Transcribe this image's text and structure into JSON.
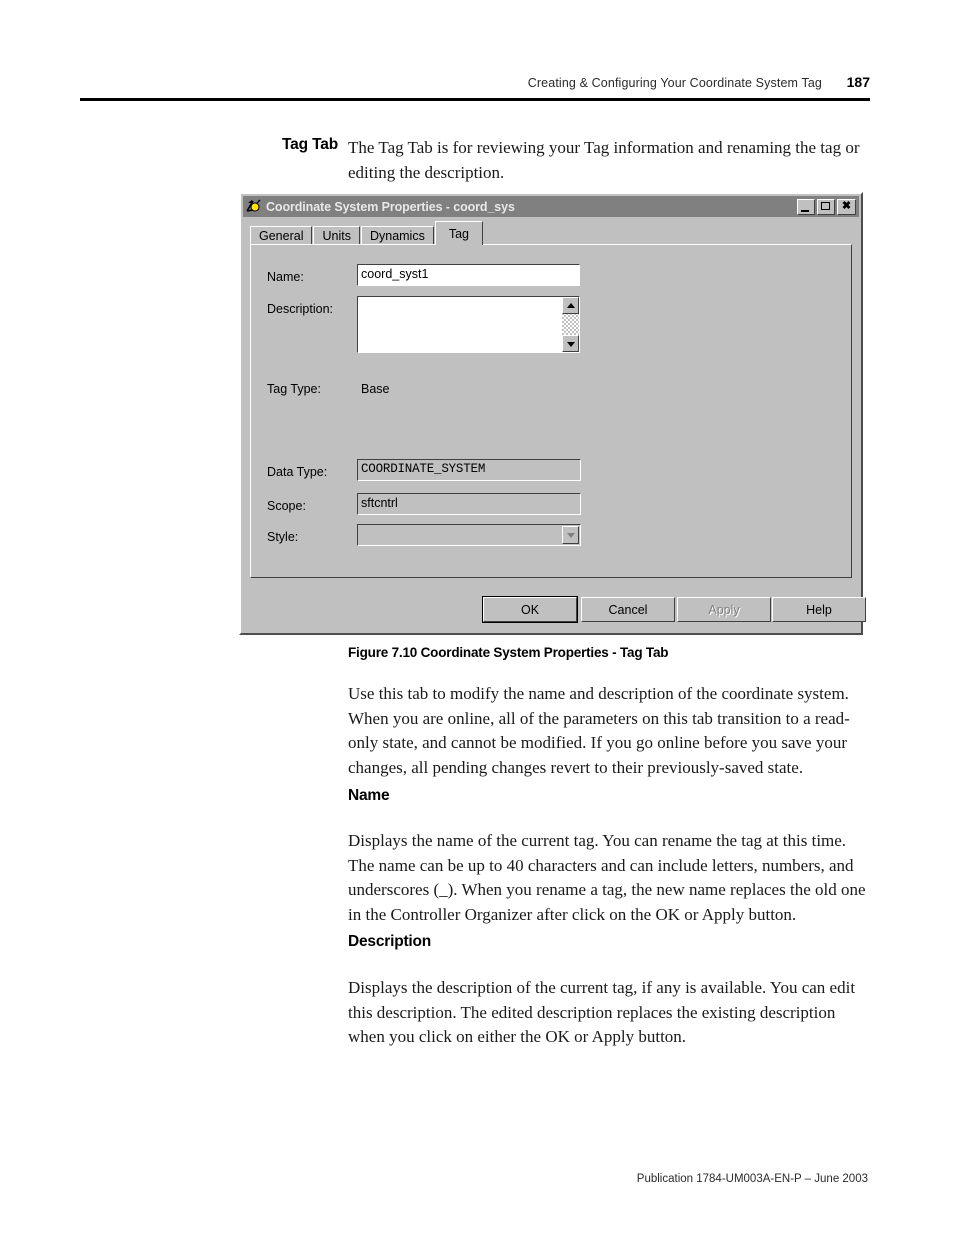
{
  "page": {
    "header_title": "Creating & Configuring Your Coordinate System Tag",
    "page_number": "187",
    "footer": "Publication 1784-UM003A-EN-P – June 2003"
  },
  "section": {
    "label": "Tag Tab",
    "intro": "The Tag Tab is for reviewing your Tag information and renaming the tag or editing the description."
  },
  "dialog": {
    "title": "Coordinate System Properties - coord_sys",
    "icon": "coordinate-system-icon",
    "window_buttons": {
      "minimize": "minimize-icon",
      "maximize": "maximize-icon",
      "close": "close-icon"
    },
    "tabs": [
      {
        "label": "General",
        "active": false
      },
      {
        "label": "Units",
        "active": false
      },
      {
        "label": "Dynamics",
        "active": false
      },
      {
        "label": "Tag",
        "active": true
      }
    ],
    "fields": {
      "name_label": "Name:",
      "name_value": "coord_syst1",
      "description_label": "Description:",
      "description_value": "",
      "tag_type_label": "Tag Type:",
      "tag_type_value": "Base",
      "data_type_label": "Data Type:",
      "data_type_value": "COORDINATE_SYSTEM",
      "scope_label": "Scope:",
      "scope_value": "sftcntrl",
      "style_label": "Style:",
      "style_value": ""
    },
    "buttons": [
      {
        "label": "OK",
        "state": "default"
      },
      {
        "label": "Cancel",
        "state": "normal"
      },
      {
        "label": "Apply",
        "state": "disabled"
      },
      {
        "label": "Help",
        "state": "normal"
      }
    ]
  },
  "figure": {
    "caption": "Figure 7.10 Coordinate System Properties - Tag Tab"
  },
  "content": {
    "overview": "Use this tab to modify the name and description of the coordinate system. When you are online, all of the parameters on this tab transition to a read-only state, and cannot be modified. If you go online before you save your changes, all pending changes revert to their previously-saved state.",
    "name_heading": "Name",
    "name_body": "Displays the name of the current tag. You can rename the tag at this time. The name can be up to 40 characters and can include letters, numbers, and underscores (_). When you rename a tag, the new name replaces the old one in the Controller Organizer after click on the OK or Apply button.",
    "description_heading": "Description",
    "description_body": "Displays the description of the current tag, if any is available. You can edit this description. The edited description replaces the existing description when you click on either the OK or Apply button."
  }
}
